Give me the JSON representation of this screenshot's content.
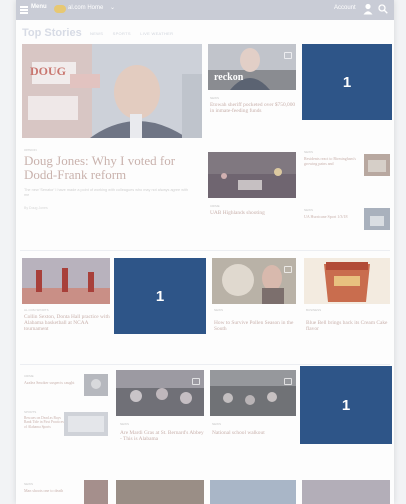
{
  "header": {
    "menu_label": "Menu",
    "brand": "al.com Home",
    "brand_chevron": "⌄",
    "account_label": "Account",
    "account_chevron": "⌄",
    "icons": [
      "menu-icon",
      "logo-icon",
      "user-icon",
      "search-icon"
    ]
  },
  "section": {
    "title": "Top Stories",
    "tabs": [
      "NEWS",
      "SPORTS",
      "LIVE WEATHER"
    ]
  },
  "stories": {
    "main": {
      "photo_sign": "DOUG",
      "kicker": "OPINION",
      "headline": "Doug Jones: Why I voted for Dodd-Frank reform",
      "summary": "The new 'Senator' I have made a point of working with colleagues who may not always agree with me",
      "byline": "By Doug Jones"
    },
    "sheriff": {
      "sign": "reckon",
      "kicker": "NEWS",
      "headline": "Etowah sheriff pocketed over $750,000 in inmate-feeding funds"
    },
    "shooting": {
      "kicker": "CRIME",
      "headline": "UAB Highlands shooting"
    },
    "small_right_1": {
      "kicker": "NEWS",
      "headline": "Residents react to Birmingham's growing pains and"
    },
    "small_right_2": {
      "kicker": "NEWS",
      "headline": "UA Hurricane Sport 1/3/18"
    },
    "collin": {
      "kicker": "AL.COM SPORTS",
      "headline": "Collin Sexton, Donta Hall practice with Alabama basketball at NCAA tournament"
    },
    "pollen": {
      "kicker": "NEWS",
      "headline": "How to Survive Pollen Season in the South"
    },
    "bluebell": {
      "kicker": "BUSINESS",
      "headline": "Blue Bell brings back its Cream Cake flavor"
    },
    "small_left_1": {
      "kicker": "CRIME",
      "headline": "Azalea Smoker suspects caught"
    },
    "small_left_2": {
      "kicker": "SPORTS",
      "headline": "Rescues on Dead as Buys Rank Tide in First Practices of Alabama Sports"
    },
    "mardi": {
      "kicker": "NEWS",
      "headline": "Are Mardi Gras at St. Bernard's Abbey - This is Alabama"
    },
    "walkout": {
      "kicker": "NEWS",
      "headline": "National school walkout"
    },
    "bottom_left": {
      "kicker": "NEWS",
      "headline": "Man shoots one to death"
    }
  },
  "ad_tiles": {
    "tile_1": "1",
    "tile_2": "1",
    "tile_3": "1"
  },
  "colors": {
    "ad_tile": "#2e5588",
    "topbar": "#c9ccd6"
  }
}
